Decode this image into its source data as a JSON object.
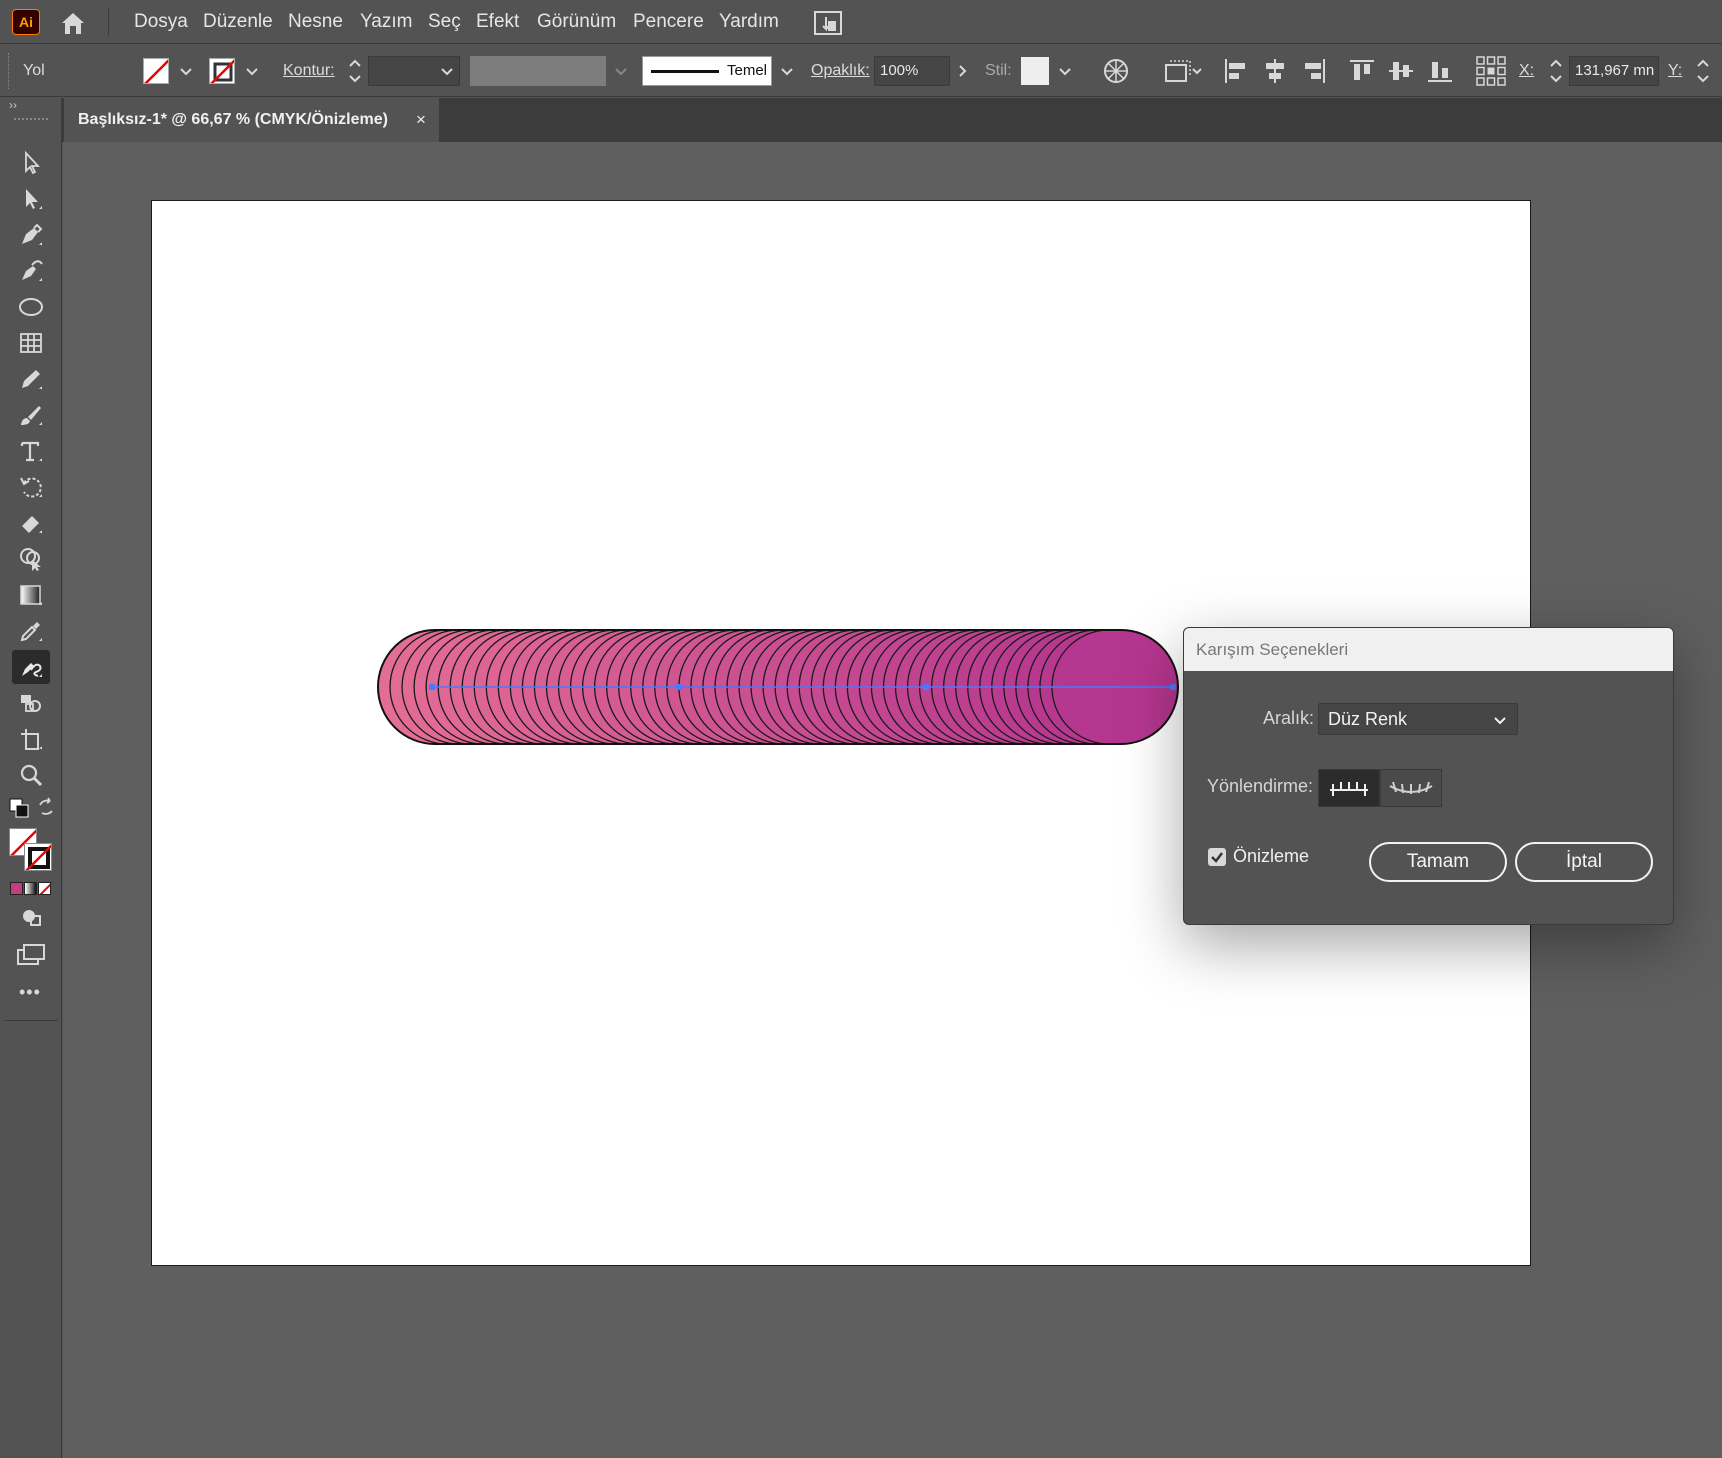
{
  "app": {
    "logo": "Ai"
  },
  "menu": [
    "Dosya",
    "Düzenle",
    "Nesne",
    "Yazım",
    "Seç",
    "Efekt",
    "Görünüm",
    "Pencere",
    "Yardım"
  ],
  "control": {
    "object_type": "Yol",
    "stroke_label": "Kontur:",
    "brush_label": "Temel",
    "opacity_label": "Opaklık:",
    "opacity_value": "100%",
    "style_label": "Stil:",
    "x_label": "X:",
    "x_value": "131,967 mn",
    "y_label": "Y:"
  },
  "tab": {
    "title": "Başlıksız-1* @ 66,67 % (CMYK/Önizleme)",
    "close": "×",
    "collapse": "››"
  },
  "tools": [
    "select-tool-icon",
    "direct-select-tool-icon",
    "pen-tool-icon",
    "curvature-tool-icon",
    "ellipse-tool-icon",
    "grid-tool-icon",
    "pencil-tool-icon",
    "paintbrush-tool-icon",
    "type-tool-icon",
    "rotate-tool-icon",
    "eraser-tool-icon",
    "shape-builder-tool-icon",
    "gradient-tool-icon",
    "eyedropper-tool-icon",
    "blend-tool-icon",
    "symbol-sprayer-tool-icon",
    "artboard-tool-icon",
    "zoom-tool-icon"
  ],
  "toolbar_more": "•••",
  "artwork": {
    "color_start": "#e46d95",
    "color_end": "#b5368f",
    "steps": 58
  },
  "dialog": {
    "title": "Karışım Seçenekleri",
    "spacing_label": "Aralık:",
    "spacing_value": "Düz Renk",
    "orientation_label": "Yönlendirme:",
    "preview_label": "Önizleme",
    "preview_checked": true,
    "ok_label": "Tamam",
    "cancel_label": "İptal"
  }
}
